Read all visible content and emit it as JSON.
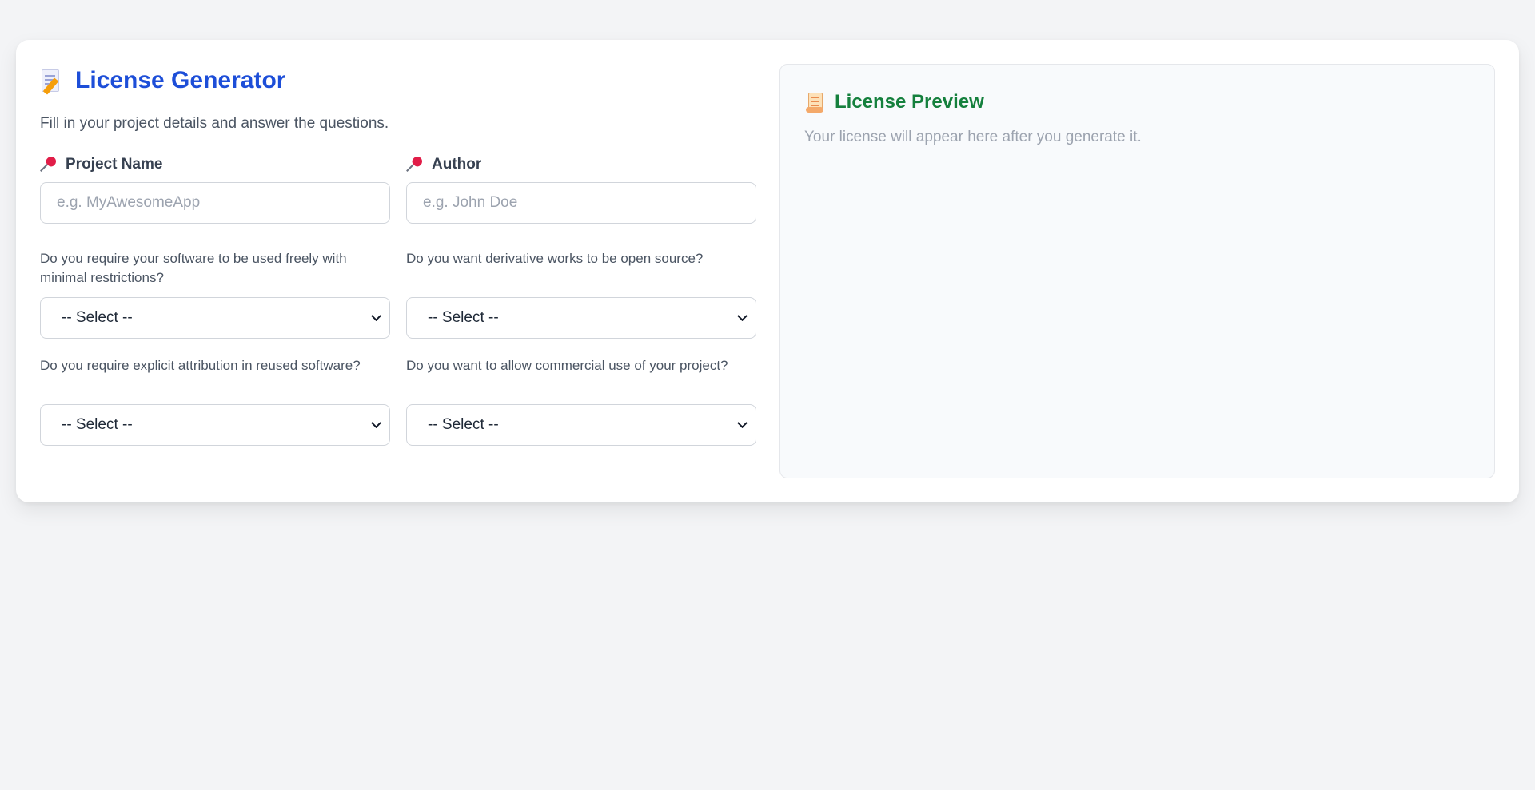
{
  "header": {
    "title": "License Generator",
    "title_icon": "memo-icon",
    "subtitle": "Fill in your project details and answer the questions."
  },
  "fields": {
    "project_name": {
      "label": "Project Name",
      "placeholder": "e.g. MyAwesomeApp",
      "value": "",
      "icon": "pushpin-icon"
    },
    "author": {
      "label": "Author",
      "placeholder": "e.g. John Doe",
      "value": "",
      "icon": "pushpin-icon"
    }
  },
  "questions": [
    {
      "text": "Do you require your software to be used freely with minimal restrictions?",
      "selected": "-- Select --"
    },
    {
      "text": "Do you want derivative works to be open source?",
      "selected": "-- Select --"
    },
    {
      "text": "Do you require explicit attribution in reused software?",
      "selected": "-- Select --"
    },
    {
      "text": "Do you want to allow commercial use of your project?",
      "selected": "-- Select --"
    }
  ],
  "preview": {
    "title": "License Preview",
    "icon": "scroll-icon",
    "placeholder": "Your license will appear here after you generate it."
  },
  "colors": {
    "accent_blue": "#1d4ed8",
    "accent_green": "#15803d",
    "background": "#f3f4f6"
  }
}
